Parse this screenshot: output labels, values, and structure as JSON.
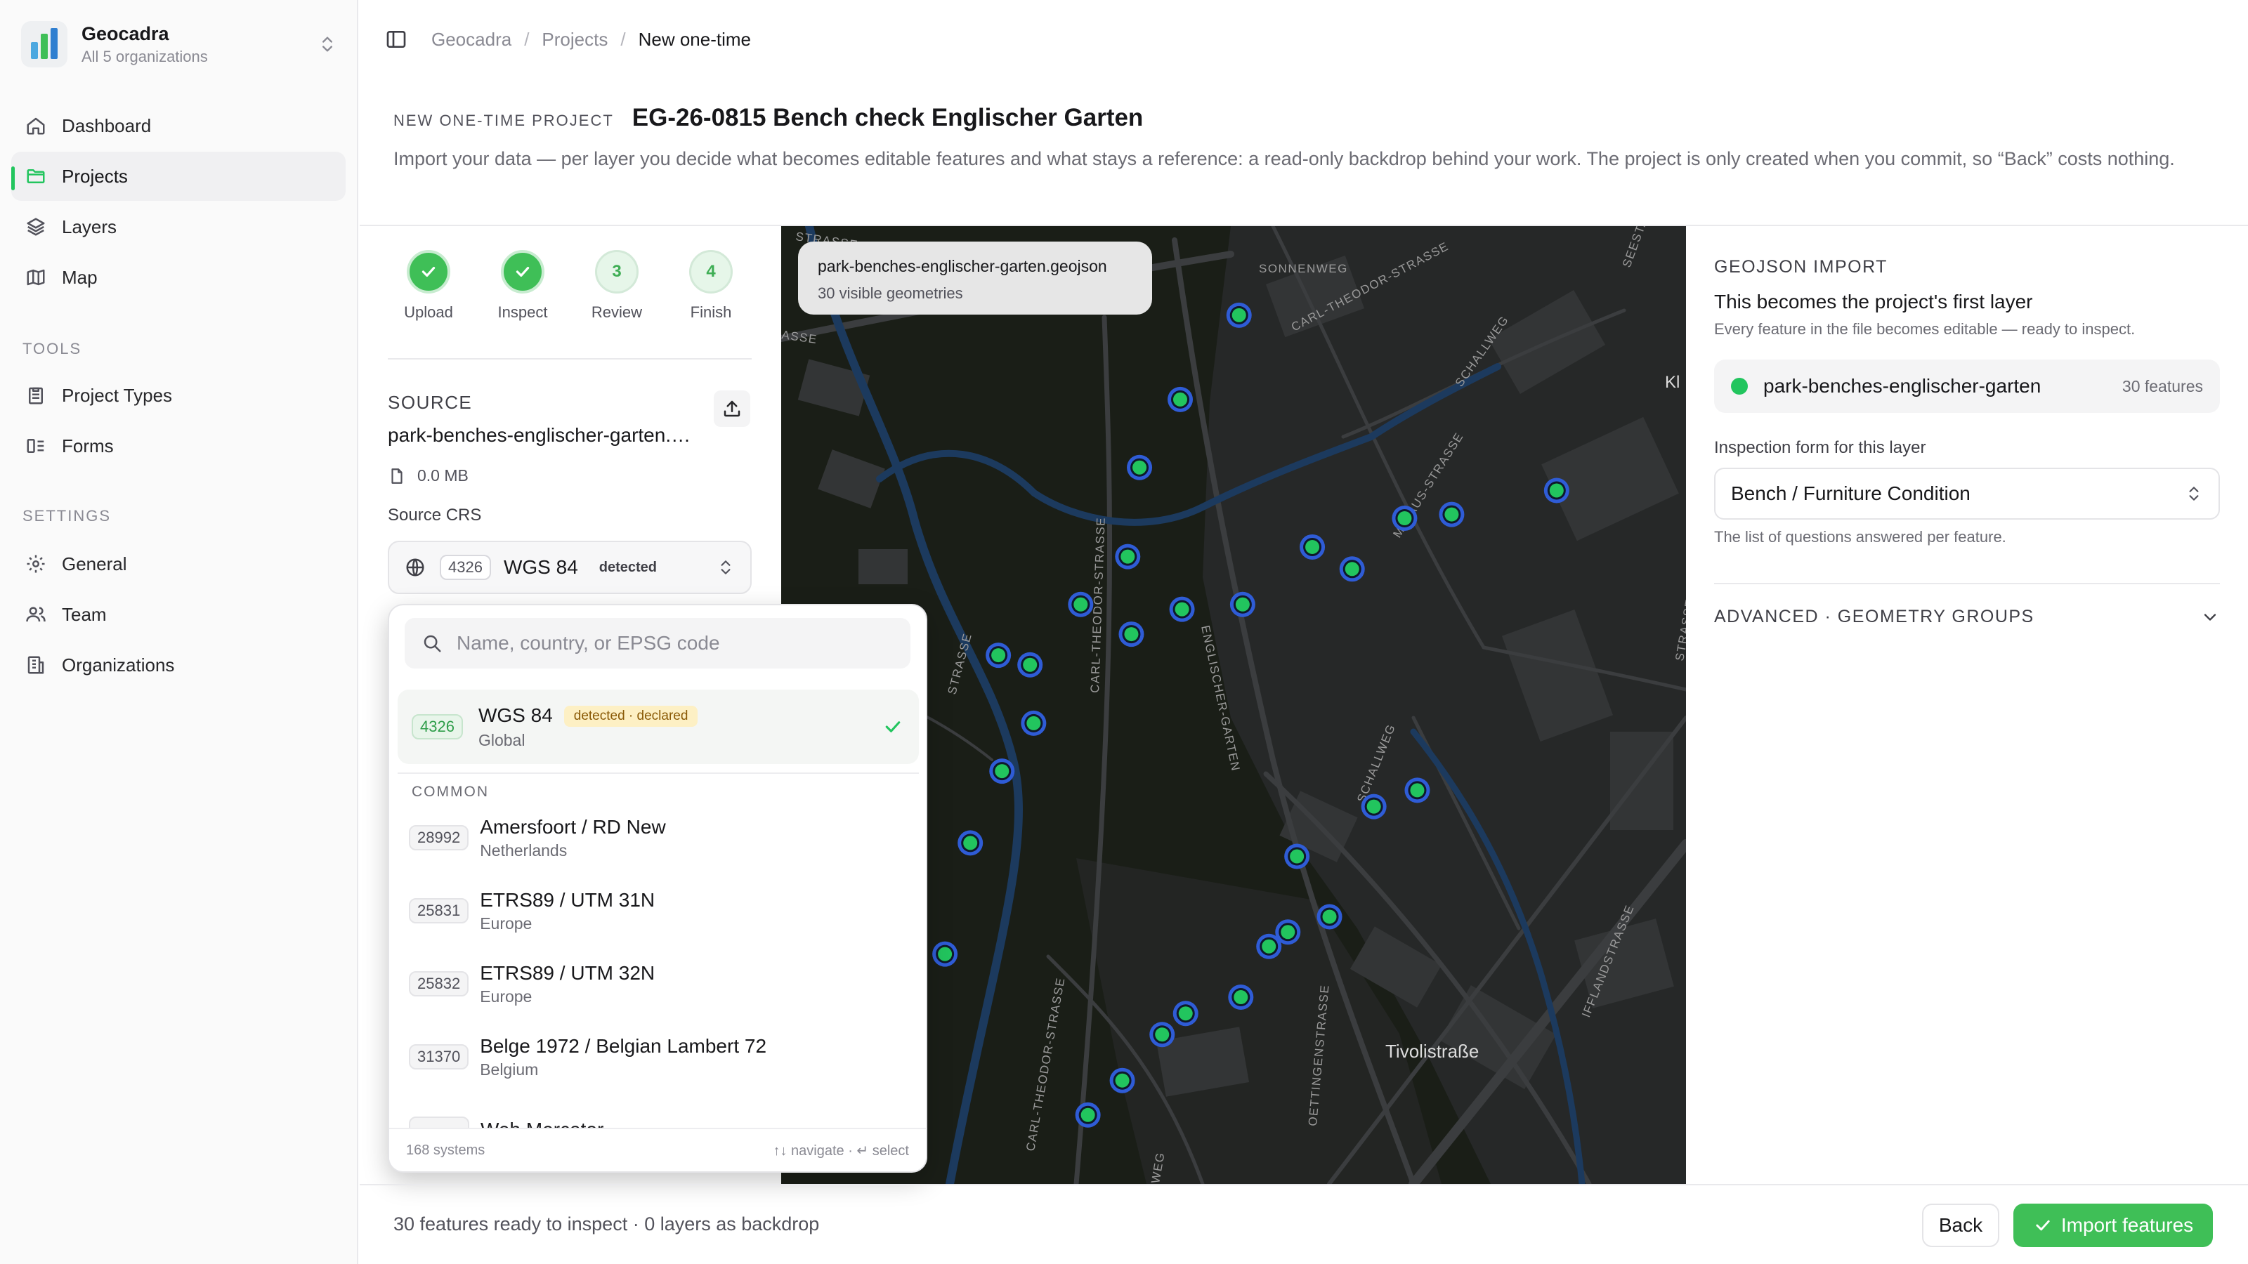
{
  "org": {
    "name": "Geocadra",
    "subtitle": "All 5 organizations"
  },
  "nav": {
    "dashboard": "Dashboard",
    "projects": "Projects",
    "layers": "Layers",
    "map": "Map",
    "tools_title": "TOOLS",
    "project_types": "Project Types",
    "forms": "Forms",
    "settings_title": "SETTINGS",
    "general": "General",
    "team": "Team",
    "organizations": "Organizations"
  },
  "breadcrumb": {
    "root": "Geocadra",
    "section": "Projects",
    "current": "New one-time"
  },
  "page": {
    "kicker": "NEW ONE-TIME PROJECT",
    "title": "EG-26-0815 Bench check Englischer Garten",
    "description": "Import your data — per layer you decide what becomes editable features and what stays a reference: a read-only backdrop behind your work. The project is only created when you commit, so “Back” costs nothing."
  },
  "steps": [
    {
      "label": "Upload",
      "number": "1",
      "done": true
    },
    {
      "label": "Inspect",
      "number": "2",
      "done": true
    },
    {
      "label": "Review",
      "number": "3",
      "done": false
    },
    {
      "label": "Finish",
      "number": "4",
      "done": false
    }
  ],
  "source": {
    "title": "SOURCE",
    "file": "park-benches-englischer-garten.geojson",
    "size": "0.0 MB",
    "crs_label": "Source CRS",
    "crs_code": "4326",
    "crs_name": "WGS 84",
    "crs_status": "detected"
  },
  "crs_dropdown": {
    "search_placeholder": "Name, country, or EPSG code",
    "selected": {
      "code": "4326",
      "name": "WGS 84",
      "tag": "detected · declared",
      "region": "Global"
    },
    "common_title": "COMMON",
    "options": [
      {
        "code": "28992",
        "name": "Amersfoort / RD New",
        "region": "Netherlands"
      },
      {
        "code": "25831",
        "name": "ETRS89 / UTM 31N",
        "region": "Europe"
      },
      {
        "code": "25832",
        "name": "ETRS89 / UTM 32N",
        "region": "Europe"
      },
      {
        "code": "31370",
        "name": "Belge 1972 / Belgian Lambert 72",
        "region": "Belgium"
      },
      {
        "code": "",
        "name": "Web Mercator",
        "region": ""
      }
    ],
    "count": "168 systems",
    "hint": "↑↓ navigate · ↵ select"
  },
  "map": {
    "tooltip_file": "park-benches-englischer-garten.geojson",
    "tooltip_count": "30 visible geometries",
    "labels": {
      "sonnenweg": "SONNENWEG",
      "carl_theodor_top": "CARL-THEODOR-STRASSE",
      "carl_theodor_mid": "CARL-THEODOR-STRASSE",
      "carl_theodor_bottom": "CARL-THEODOR-STRASSE",
      "schallweg_top": "SCHALLWEG",
      "schallweg_mid": "SCHALLWEG",
      "mhaus": "M-HAUS-STRASSE",
      "englischer": "ENGLISCHER-GARTEN",
      "oettingen": "OETTINGENSTRASSE",
      "ifflandstrasse": "IFFLANDSTRASSE",
      "tivolistrasse": "Tivolistraße",
      "kl": "Kl",
      "strasse_left": "STRASSE",
      "strasse_left2": "STRASSE",
      "asse": "ASSE",
      "strasse_right": "STRASSE",
      "seesta": "SEESTA",
      "weg_bottom": "WEG"
    },
    "points": [
      [
        0.506,
        0.093
      ],
      [
        0.441,
        0.181
      ],
      [
        0.396,
        0.252
      ],
      [
        0.383,
        0.345
      ],
      [
        0.331,
        0.395
      ],
      [
        0.387,
        0.426
      ],
      [
        0.443,
        0.4
      ],
      [
        0.51,
        0.395
      ],
      [
        0.587,
        0.335
      ],
      [
        0.631,
        0.358
      ],
      [
        0.689,
        0.305
      ],
      [
        0.741,
        0.301
      ],
      [
        0.857,
        0.276
      ],
      [
        0.24,
        0.448
      ],
      [
        0.275,
        0.458
      ],
      [
        0.279,
        0.519
      ],
      [
        0.244,
        0.569
      ],
      [
        0.209,
        0.644
      ],
      [
        0.181,
        0.76
      ],
      [
        0.57,
        0.658
      ],
      [
        0.655,
        0.606
      ],
      [
        0.703,
        0.589
      ],
      [
        0.606,
        0.721
      ],
      [
        0.539,
        0.752
      ],
      [
        0.508,
        0.805
      ],
      [
        0.447,
        0.822
      ],
      [
        0.421,
        0.844
      ],
      [
        0.377,
        0.892
      ],
      [
        0.339,
        0.928
      ],
      [
        0.56,
        0.737
      ]
    ]
  },
  "geojson": {
    "kicker": "GEOJSON IMPORT",
    "title": "This becomes the project's first layer",
    "subtitle": "Every feature in the file becomes editable — ready to inspect.",
    "layer_name": "park-benches-englischer-garten",
    "layer_count": "30 features",
    "form_label": "Inspection form for this layer",
    "form_value": "Bench / Furniture Condition",
    "form_help": "The list of questions answered per feature.",
    "advanced": "ADVANCED · GEOMETRY GROUPS"
  },
  "footer": {
    "status": "30 features ready to inspect · 0 layers as backdrop",
    "back": "Back",
    "import": "Import features"
  },
  "colors": {
    "accent": "#3fbf57",
    "map_bg": "#1a1e17",
    "water": "#1c3a5e",
    "marker_fill": "#22c55e",
    "marker_ring": "#2f5cd6"
  }
}
